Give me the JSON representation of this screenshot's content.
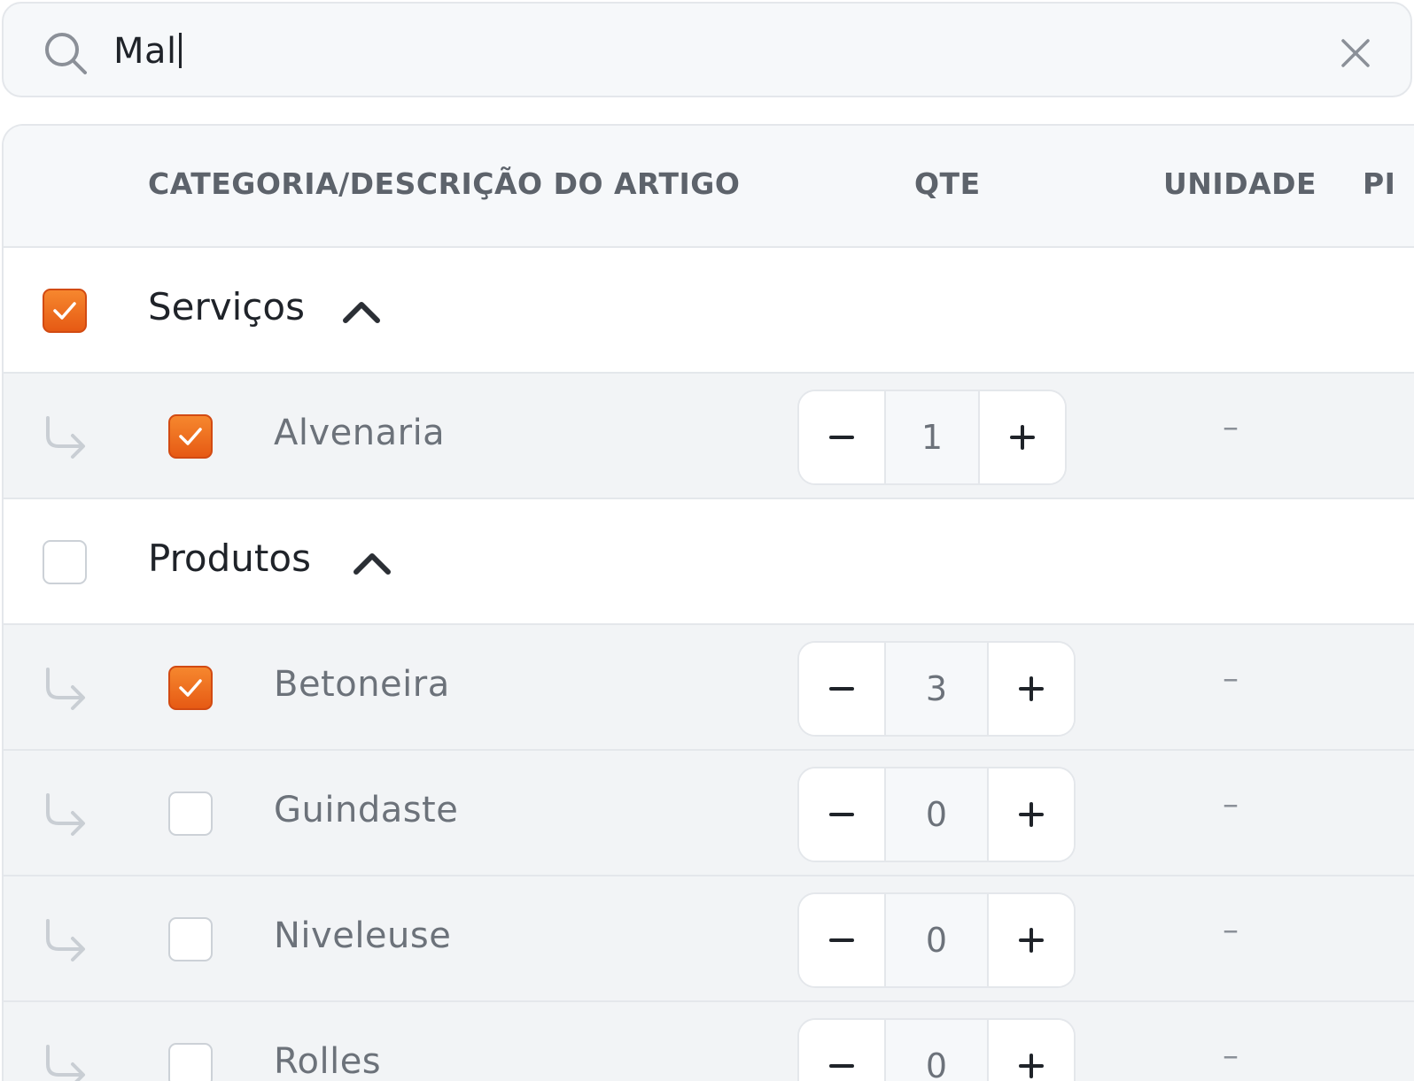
{
  "search": {
    "query": "Mal"
  },
  "table": {
    "columns": {
      "description": "CATEGORIA/DESCRIÇÃO DO ARTIGO",
      "quantity": "QTE",
      "unit": "UNIDADE",
      "price": "PI"
    },
    "categories": [
      {
        "label": "Serviços",
        "checked": true,
        "expanded": true,
        "items": [
          {
            "label": "Alvenaria",
            "checked": true,
            "quantity": "1",
            "unit": "–"
          }
        ]
      },
      {
        "label": "Produtos",
        "checked": false,
        "expanded": true,
        "items": [
          {
            "label": "Betoneira",
            "checked": true,
            "quantity": "3",
            "unit": "–"
          },
          {
            "label": "Guindaste",
            "checked": false,
            "quantity": "0",
            "unit": "–"
          },
          {
            "label": "Niveleuse",
            "checked": false,
            "quantity": "0",
            "unit": "–"
          },
          {
            "label": "Rolles",
            "checked": false,
            "quantity": "0",
            "unit": "–"
          }
        ]
      }
    ]
  },
  "colors": {
    "accent": "#ef6b1f",
    "header_bg": "#f6f8fa",
    "item_row_bg": "#f2f4f6",
    "border": "#e4e7eb"
  },
  "icons": {
    "search": "search-icon",
    "clear": "close-icon",
    "collapse": "chevron-up-icon",
    "child": "subdirectory-arrow-icon",
    "check": "check-icon",
    "decrement": "minus-icon",
    "increment": "plus-icon"
  }
}
